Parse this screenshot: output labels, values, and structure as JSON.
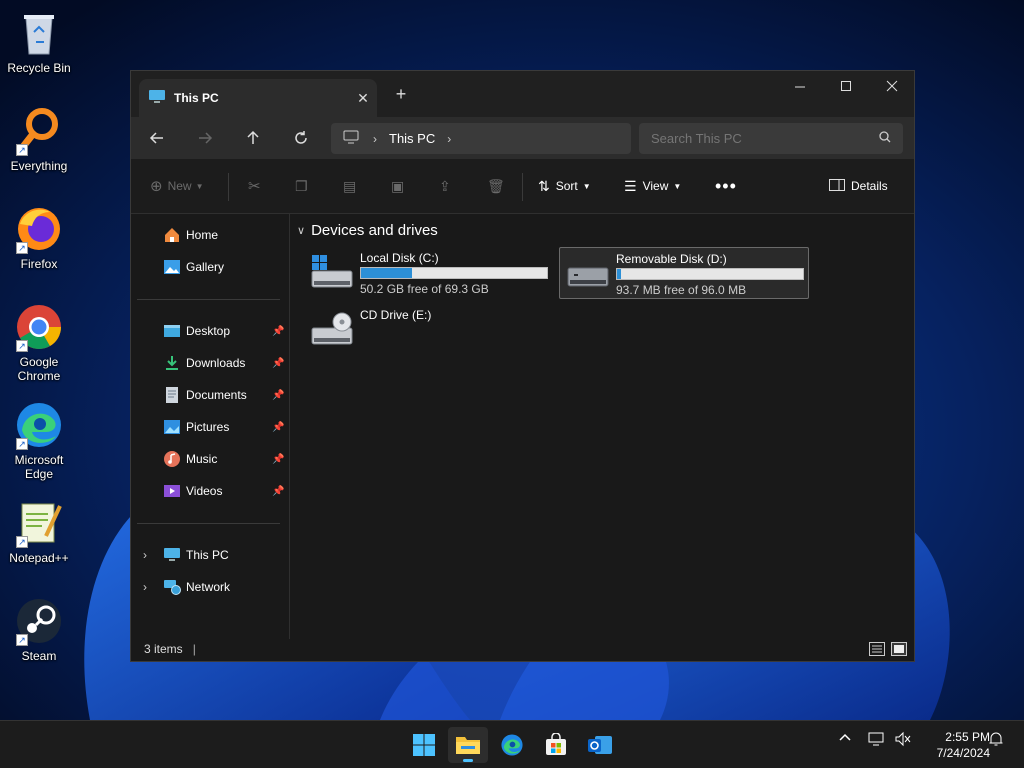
{
  "desktop": {
    "icons": [
      {
        "name": "Recycle Bin",
        "icon": "recycle-bin-icon"
      },
      {
        "name": "Everything",
        "icon": "everything-search-icon"
      },
      {
        "name": "Firefox",
        "icon": "firefox-icon"
      },
      {
        "name": "Google Chrome",
        "icon": "chrome-icon"
      },
      {
        "name": "Microsoft Edge",
        "icon": "edge-icon"
      },
      {
        "name": "Notepad++",
        "icon": "notepadpp-icon"
      },
      {
        "name": "Steam",
        "icon": "steam-icon"
      }
    ]
  },
  "window": {
    "tab_title": "This PC",
    "address": {
      "crumbs": [
        "This PC"
      ]
    },
    "search": {
      "placeholder": "Search This PC"
    },
    "toolbar": {
      "new_label": "New",
      "sort_label": "Sort",
      "view_label": "View",
      "details_label": "Details"
    },
    "sidebar": {
      "quick": [
        {
          "label": "Home",
          "icon": "home-icon"
        },
        {
          "label": "Gallery",
          "icon": "gallery-icon"
        }
      ],
      "pinned": [
        {
          "label": "Desktop",
          "icon": "desktop-folder-icon"
        },
        {
          "label": "Downloads",
          "icon": "downloads-icon"
        },
        {
          "label": "Documents",
          "icon": "documents-icon"
        },
        {
          "label": "Pictures",
          "icon": "pictures-icon"
        },
        {
          "label": "Music",
          "icon": "music-icon"
        },
        {
          "label": "Videos",
          "icon": "videos-icon"
        }
      ],
      "locations": [
        {
          "label": "This PC",
          "icon": "this-pc-icon"
        },
        {
          "label": "Network",
          "icon": "network-icon"
        }
      ]
    },
    "group": "Devices and drives",
    "drives": [
      {
        "name": "Local Disk (C:)",
        "free": "50.2 GB free of 69.3 GB",
        "used_fraction": 0.276,
        "icon": "local-disk-icon"
      },
      {
        "name": "Removable Disk (D:)",
        "free": "93.7 MB free of 96.0 MB",
        "used_fraction": 0.024,
        "icon": "removable-disk-icon"
      },
      {
        "name": "CD Drive (E:)",
        "icon": "cd-drive-icon"
      }
    ],
    "status": "3 items"
  },
  "taskbar": {
    "time": "2:55 PM",
    "date": "7/24/2024",
    "apps": [
      "start-icon",
      "file-explorer-icon",
      "edge-icon",
      "store-icon",
      "outlook-icon"
    ]
  },
  "colors": {
    "accent": "#2c8fd6",
    "window_bg": "#191919",
    "taskbar_bg": "#1c1c1c"
  }
}
